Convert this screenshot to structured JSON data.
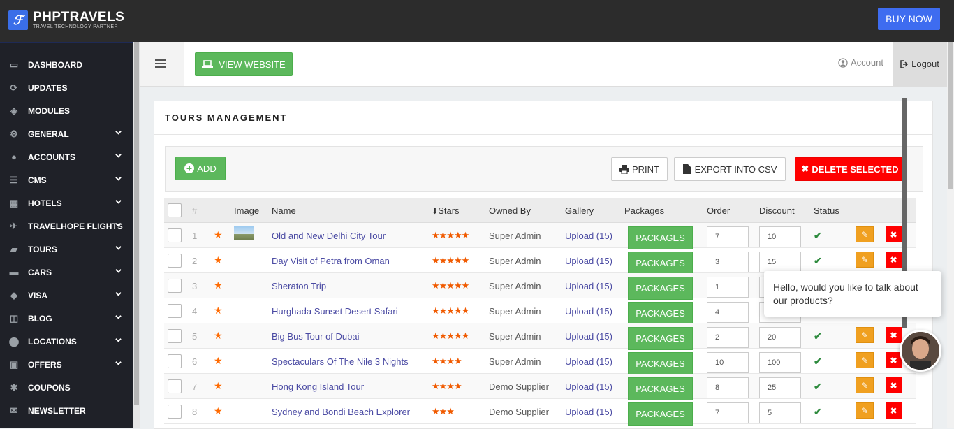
{
  "brand": {
    "title": "PHPTRAVELS",
    "subtitle": "TRAVEL TECHNOLOGY PARTNER",
    "accent": "#3a6ee8"
  },
  "topbar": {
    "buy_now": "BUY NOW"
  },
  "sidebar": {
    "items": [
      {
        "label": "DASHBOARD",
        "icon": "monitor-icon",
        "glyph": "▭",
        "chevron": false
      },
      {
        "label": "UPDATES",
        "icon": "refresh-icon",
        "glyph": "⟳",
        "chevron": false
      },
      {
        "label": "MODULES",
        "icon": "cube-icon",
        "glyph": "◈",
        "chevron": false
      },
      {
        "label": "GENERAL",
        "icon": "gear-icon",
        "glyph": "⚙",
        "chevron": true
      },
      {
        "label": "ACCOUNTS",
        "icon": "user-circle-icon",
        "glyph": "●",
        "chevron": true
      },
      {
        "label": "CMS",
        "icon": "list-icon",
        "glyph": "☰",
        "chevron": true
      },
      {
        "label": "HOTELS",
        "icon": "building-icon",
        "glyph": "▦",
        "chevron": true
      },
      {
        "label": "TRAVELHOPE FLIGHTS",
        "icon": "plane-icon",
        "glyph": "✈",
        "chevron": true
      },
      {
        "label": "TOURS",
        "icon": "briefcase-icon",
        "glyph": "▰",
        "chevron": true
      },
      {
        "label": "CARS",
        "icon": "car-icon",
        "glyph": "▬",
        "chevron": true
      },
      {
        "label": "VISA",
        "icon": "tag-icon",
        "glyph": "◆",
        "chevron": true
      },
      {
        "label": "BLOG",
        "icon": "columns-icon",
        "glyph": "◫",
        "chevron": true
      },
      {
        "label": "LOCATIONS",
        "icon": "map-pin-icon",
        "glyph": "⬤",
        "chevron": true
      },
      {
        "label": "OFFERS",
        "icon": "gift-icon",
        "glyph": "▣",
        "chevron": true
      },
      {
        "label": "COUPONS",
        "icon": "asterisk-icon",
        "glyph": "✱",
        "chevron": false
      },
      {
        "label": "NEWSLETTER",
        "icon": "envelope-icon",
        "glyph": "✉",
        "chevron": false
      }
    ]
  },
  "header": {
    "view_website": "VIEW WEBSITE",
    "account": "Account",
    "logout": "Logout"
  },
  "panel": {
    "title": "TOURS MANAGEMENT"
  },
  "toolbar": {
    "add": "ADD",
    "print": "PRINT",
    "export_csv": "EXPORT INTO CSV",
    "delete_selected": "DELETE SELECTED"
  },
  "table": {
    "headers": {
      "num": "#",
      "image": "Image",
      "name": "Name",
      "stars": "Stars",
      "owned_by": "Owned By",
      "gallery": "Gallery",
      "packages": "Packages",
      "order": "Order",
      "discount": "Discount",
      "status": "Status"
    },
    "packages_label": "PACKAGES",
    "rows": [
      {
        "num": "1",
        "name": "Old and New Delhi City Tour",
        "stars": "★★★★★",
        "owner": "Super Admin",
        "gallery": "Upload (15)",
        "order": "7",
        "discount": "10",
        "has_image": true
      },
      {
        "num": "2",
        "name": "Day Visit of Petra from Oman",
        "stars": "★★★★★",
        "owner": "Super Admin",
        "gallery": "Upload (15)",
        "order": "3",
        "discount": "15",
        "has_image": false
      },
      {
        "num": "3",
        "name": "Sheraton Trip",
        "stars": "★★★★★",
        "owner": "Super Admin",
        "gallery": "Upload (15)",
        "order": "1",
        "discount": "",
        "has_image": false
      },
      {
        "num": "4",
        "name": "Hurghada Sunset Desert Safari",
        "stars": "★★★★★",
        "owner": "Super Admin",
        "gallery": "Upload (15)",
        "order": "4",
        "discount": "",
        "has_image": false
      },
      {
        "num": "5",
        "name": "Big Bus Tour of Dubai",
        "stars": "★★★★★",
        "owner": "Super Admin",
        "gallery": "Upload (15)",
        "order": "2",
        "discount": "20",
        "has_image": false
      },
      {
        "num": "6",
        "name": "Spectaculars Of The Nile 3 Nights",
        "stars": "★★★★",
        "owner": "Super Admin",
        "gallery": "Upload (15)",
        "order": "10",
        "discount": "100",
        "has_image": false
      },
      {
        "num": "7",
        "name": "Hong Kong Island Tour",
        "stars": "★★★★",
        "owner": "Demo Supplier",
        "gallery": "Upload (15)",
        "order": "8",
        "discount": "25",
        "has_image": false
      },
      {
        "num": "8",
        "name": "Sydney and Bondi Beach Explorer",
        "stars": "★★★",
        "owner": "Demo Supplier",
        "gallery": "Upload (15)",
        "order": "7",
        "discount": "5",
        "has_image": false
      }
    ]
  },
  "chat": {
    "message": "Hello, would you like to talk about our products?"
  },
  "colors": {
    "green": "#5cb85c",
    "red": "#ff0000",
    "orange": "#f0a020",
    "blue": "#3e6cf0",
    "sidebar_bg": "#1f2128"
  }
}
